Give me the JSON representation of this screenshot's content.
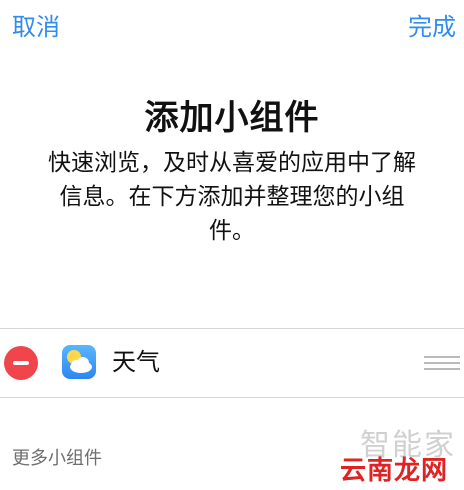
{
  "nav": {
    "cancel_label": "取消",
    "done_label": "完成"
  },
  "header": {
    "title": "添加小组件",
    "description": "快速浏览，及时从喜爱的应用中了解信息。在下方添加并整理您的小组件。"
  },
  "widgets": [
    {
      "name": "天气",
      "icon": "weather-icon"
    }
  ],
  "more_section": {
    "label": "更多小组件"
  },
  "watermark": {
    "line1": "智能家",
    "line2": "云南龙网"
  },
  "colors": {
    "accent": "#2f8cf0",
    "remove": "#f0454a",
    "watermark_red": "#e02222"
  }
}
